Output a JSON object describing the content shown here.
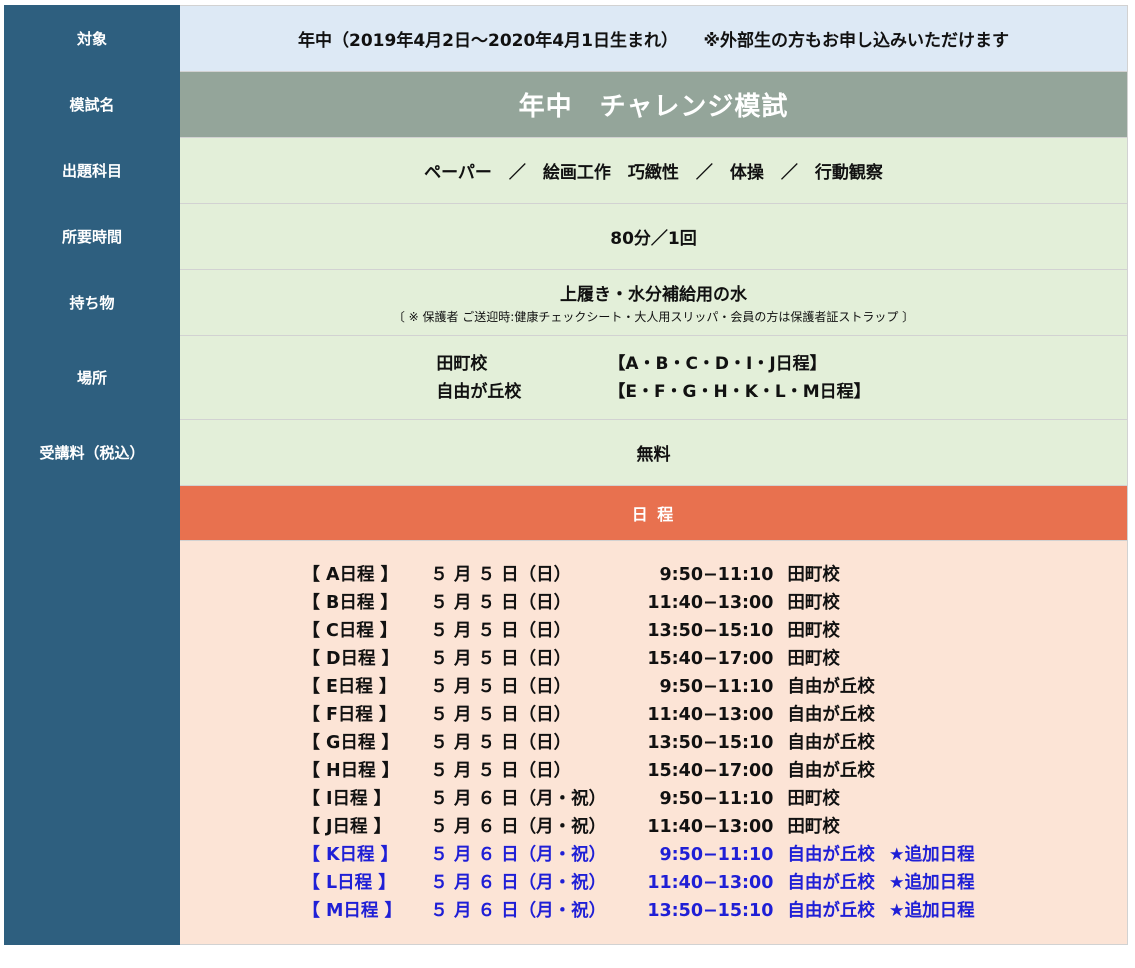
{
  "rows": {
    "target": {
      "label": "対象",
      "value": "年中（2019年4月2日～2020年4月1日生まれ）　　※外部生の方もお申し込みいただけます"
    },
    "exam_name": {
      "label": "模試名",
      "value": "年中　チャレンジ模試"
    },
    "subjects": {
      "label": "出題科目",
      "value": "ペーパー　／　絵画工作　巧緻性　／　体操　／　行動観察"
    },
    "duration": {
      "label": "所要時間",
      "value": "80分／1回"
    },
    "belongings": {
      "label": "持ち物",
      "value": "上履き・水分補給用の水",
      "note": "〔 ※ 保護者 ご送迎時:健康チェックシート・大人用スリッパ・会員の方は保護者証ストラップ 〕"
    },
    "location": {
      "label": "場所",
      "venues": [
        {
          "name": "田町校",
          "schedules": "【A・B・C・D・I・J日程】"
        },
        {
          "name": "自由が丘校",
          "schedules": "【E・F・G・H・K・L・M日程】"
        }
      ]
    },
    "fee": {
      "label": "受講料（税込）",
      "value": "無料"
    }
  },
  "schedule_header": "日 程",
  "schedule": [
    {
      "code": "【 A日程 】",
      "date": "５ 月 ５ 日（日）",
      "time": "9:50−11:10",
      "venue": "田町校",
      "note": "",
      "added": false
    },
    {
      "code": "【 B日程 】",
      "date": "５ 月 ５ 日（日）",
      "time": "11:40−13:00",
      "venue": "田町校",
      "note": "",
      "added": false
    },
    {
      "code": "【 C日程 】",
      "date": "５ 月 ５ 日（日）",
      "time": "13:50−15:10",
      "venue": "田町校",
      "note": "",
      "added": false
    },
    {
      "code": "【 D日程 】",
      "date": "５ 月 ５ 日（日）",
      "time": "15:40−17:00",
      "venue": "田町校",
      "note": "",
      "added": false
    },
    {
      "code": "【 E日程 】",
      "date": "５ 月 ５ 日（日）",
      "time": "9:50−11:10",
      "venue": "自由が丘校",
      "note": "",
      "added": false
    },
    {
      "code": "【 F日程 】",
      "date": "５ 月 ５ 日（日）",
      "time": "11:40−13:00",
      "venue": "自由が丘校",
      "note": "",
      "added": false
    },
    {
      "code": "【 G日程 】",
      "date": "５ 月 ５ 日（日）",
      "time": "13:50−15:10",
      "venue": "自由が丘校",
      "note": "",
      "added": false
    },
    {
      "code": "【 H日程 】",
      "date": "５ 月 ５ 日（日）",
      "time": "15:40−17:00",
      "venue": "自由が丘校",
      "note": "",
      "added": false
    },
    {
      "code": "【 I日程 】",
      "date": "５ 月 ６ 日（月・祝）",
      "time": "9:50−11:10",
      "venue": "田町校",
      "note": "",
      "added": false
    },
    {
      "code": "【 J日程 】",
      "date": "５ 月 ６ 日（月・祝）",
      "time": "11:40−13:00",
      "venue": "田町校",
      "note": "",
      "added": false
    },
    {
      "code": "【 K日程 】",
      "date": "５ 月 ６ 日（月・祝）",
      "time": "9:50−11:10",
      "venue": "自由が丘校",
      "note": "★追加日程",
      "added": true
    },
    {
      "code": "【 L日程 】",
      "date": "５ 月 ６ 日（月・祝）",
      "time": "11:40−13:00",
      "venue": "自由が丘校",
      "note": "★追加日程",
      "added": true
    },
    {
      "code": "【 M日程 】",
      "date": "５ 月 ６ 日（月・祝）",
      "time": "13:50−15:10",
      "venue": "自由が丘校",
      "note": "★追加日程",
      "added": true
    }
  ],
  "colors": {
    "label_bg": "#2e5f7f",
    "target_bg": "#dde9f5",
    "title_bg": "#94a59a",
    "green_bg": "#e3efd9",
    "schedule_header_bg": "#e8714f",
    "schedule_bg": "#fce4d6",
    "added_text": "#1f1fd6"
  }
}
